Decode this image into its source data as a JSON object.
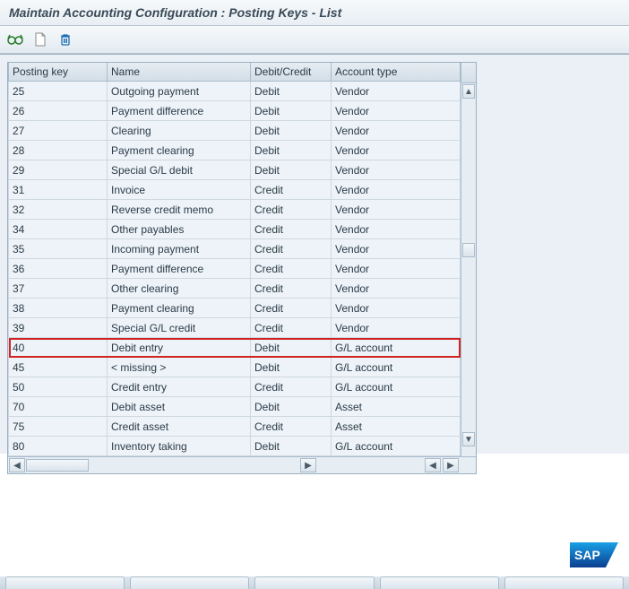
{
  "title": "Maintain Accounting Configuration : Posting Keys - List",
  "toolbar": {
    "glasses_icon": "glasses-icon",
    "new_icon": "new-page-icon",
    "delete_icon": "trash-icon"
  },
  "table": {
    "headers": {
      "key": "Posting key",
      "name": "Name",
      "dc": "Debit/Credit",
      "acc": "Account type"
    },
    "rows": [
      {
        "key": "25",
        "name": "Outgoing payment",
        "dc": "Debit",
        "acc": "Vendor",
        "first": true
      },
      {
        "key": "26",
        "name": "Payment difference",
        "dc": "Debit",
        "acc": "Vendor"
      },
      {
        "key": "27",
        "name": "Clearing",
        "dc": "Debit",
        "acc": "Vendor"
      },
      {
        "key": "28",
        "name": "Payment clearing",
        "dc": "Debit",
        "acc": "Vendor"
      },
      {
        "key": "29",
        "name": "Special G/L debit",
        "dc": "Debit",
        "acc": "Vendor"
      },
      {
        "key": "31",
        "name": "Invoice",
        "dc": "Credit",
        "acc": "Vendor"
      },
      {
        "key": "32",
        "name": "Reverse credit memo",
        "dc": "Credit",
        "acc": "Vendor"
      },
      {
        "key": "34",
        "name": "Other payables",
        "dc": "Credit",
        "acc": "Vendor"
      },
      {
        "key": "35",
        "name": "Incoming payment",
        "dc": "Credit",
        "acc": "Vendor"
      },
      {
        "key": "36",
        "name": "Payment difference",
        "dc": "Credit",
        "acc": "Vendor"
      },
      {
        "key": "37",
        "name": "Other clearing",
        "dc": "Credit",
        "acc": "Vendor"
      },
      {
        "key": "38",
        "name": "Payment clearing",
        "dc": "Credit",
        "acc": "Vendor"
      },
      {
        "key": "39",
        "name": "Special G/L credit",
        "dc": "Credit",
        "acc": "Vendor"
      },
      {
        "key": "40",
        "name": "Debit entry",
        "dc": "Debit",
        "acc": "G/L account",
        "highlight": true
      },
      {
        "key": "45",
        "name": "< missing >",
        "dc": "Debit",
        "acc": "G/L account"
      },
      {
        "key": "50",
        "name": "Credit entry",
        "dc": "Credit",
        "acc": "G/L account"
      },
      {
        "key": "70",
        "name": "Debit asset",
        "dc": "Debit",
        "acc": "Asset"
      },
      {
        "key": "75",
        "name": "Credit asset",
        "dc": "Credit",
        "acc": "Asset"
      },
      {
        "key": "80",
        "name": "Inventory taking",
        "dc": "Debit",
        "acc": "G/L account"
      }
    ]
  }
}
